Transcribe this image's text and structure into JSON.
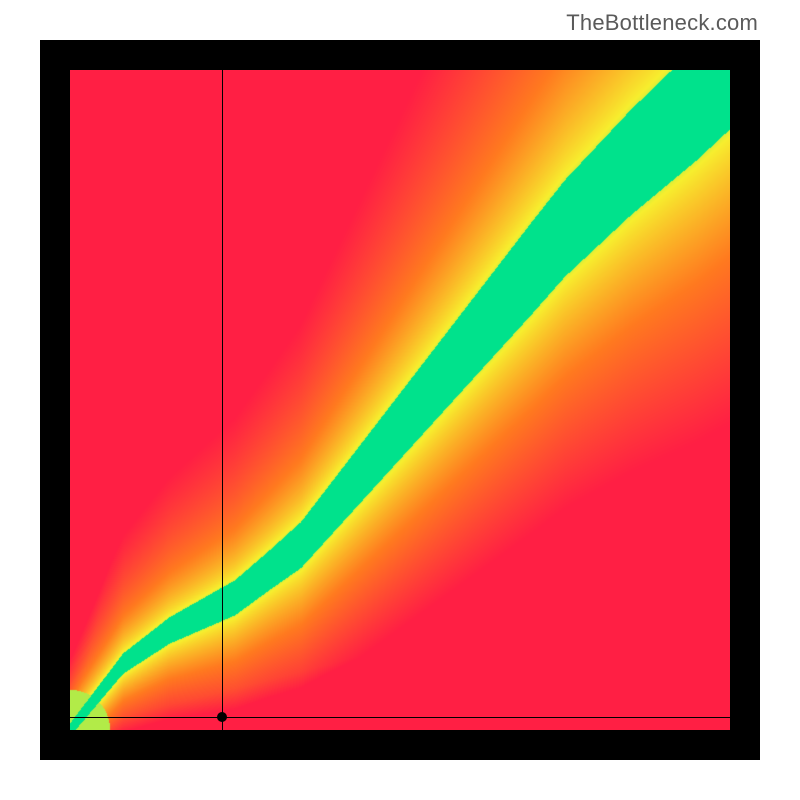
{
  "watermark": "TheBottleneck.com",
  "chart_data": {
    "type": "heatmap",
    "title": "",
    "xlabel": "",
    "ylabel": "",
    "xlim": [
      0,
      100
    ],
    "ylim": [
      0,
      100
    ],
    "marker": {
      "x": 23,
      "y": 2
    },
    "crosshair": {
      "x": 23,
      "y": 2
    },
    "colorscale": {
      "description": "green = balanced, yellow = mild bottleneck, red = severe bottleneck",
      "stops": [
        {
          "value": 0.0,
          "color": "#00e28c"
        },
        {
          "value": 0.25,
          "color": "#f7ef2e"
        },
        {
          "value": 0.6,
          "color": "#ff7a1f"
        },
        {
          "value": 1.0,
          "color": "#ff1f44"
        }
      ]
    },
    "optimal_band": {
      "description": "approx. centerline of the green balanced region, y as function of x (0-100 scale)",
      "points": [
        {
          "x": 0,
          "y": 0
        },
        {
          "x": 8,
          "y": 10
        },
        {
          "x": 15,
          "y": 15
        },
        {
          "x": 25,
          "y": 20
        },
        {
          "x": 35,
          "y": 28
        },
        {
          "x": 45,
          "y": 40
        },
        {
          "x": 55,
          "y": 52
        },
        {
          "x": 65,
          "y": 64
        },
        {
          "x": 75,
          "y": 76
        },
        {
          "x": 85,
          "y": 86
        },
        {
          "x": 95,
          "y": 95
        },
        {
          "x": 100,
          "y": 100
        }
      ],
      "half_width": [
        {
          "x": 0,
          "w": 1
        },
        {
          "x": 15,
          "w": 2
        },
        {
          "x": 30,
          "w": 3
        },
        {
          "x": 50,
          "w": 5
        },
        {
          "x": 70,
          "w": 7
        },
        {
          "x": 100,
          "w": 9
        }
      ]
    }
  }
}
